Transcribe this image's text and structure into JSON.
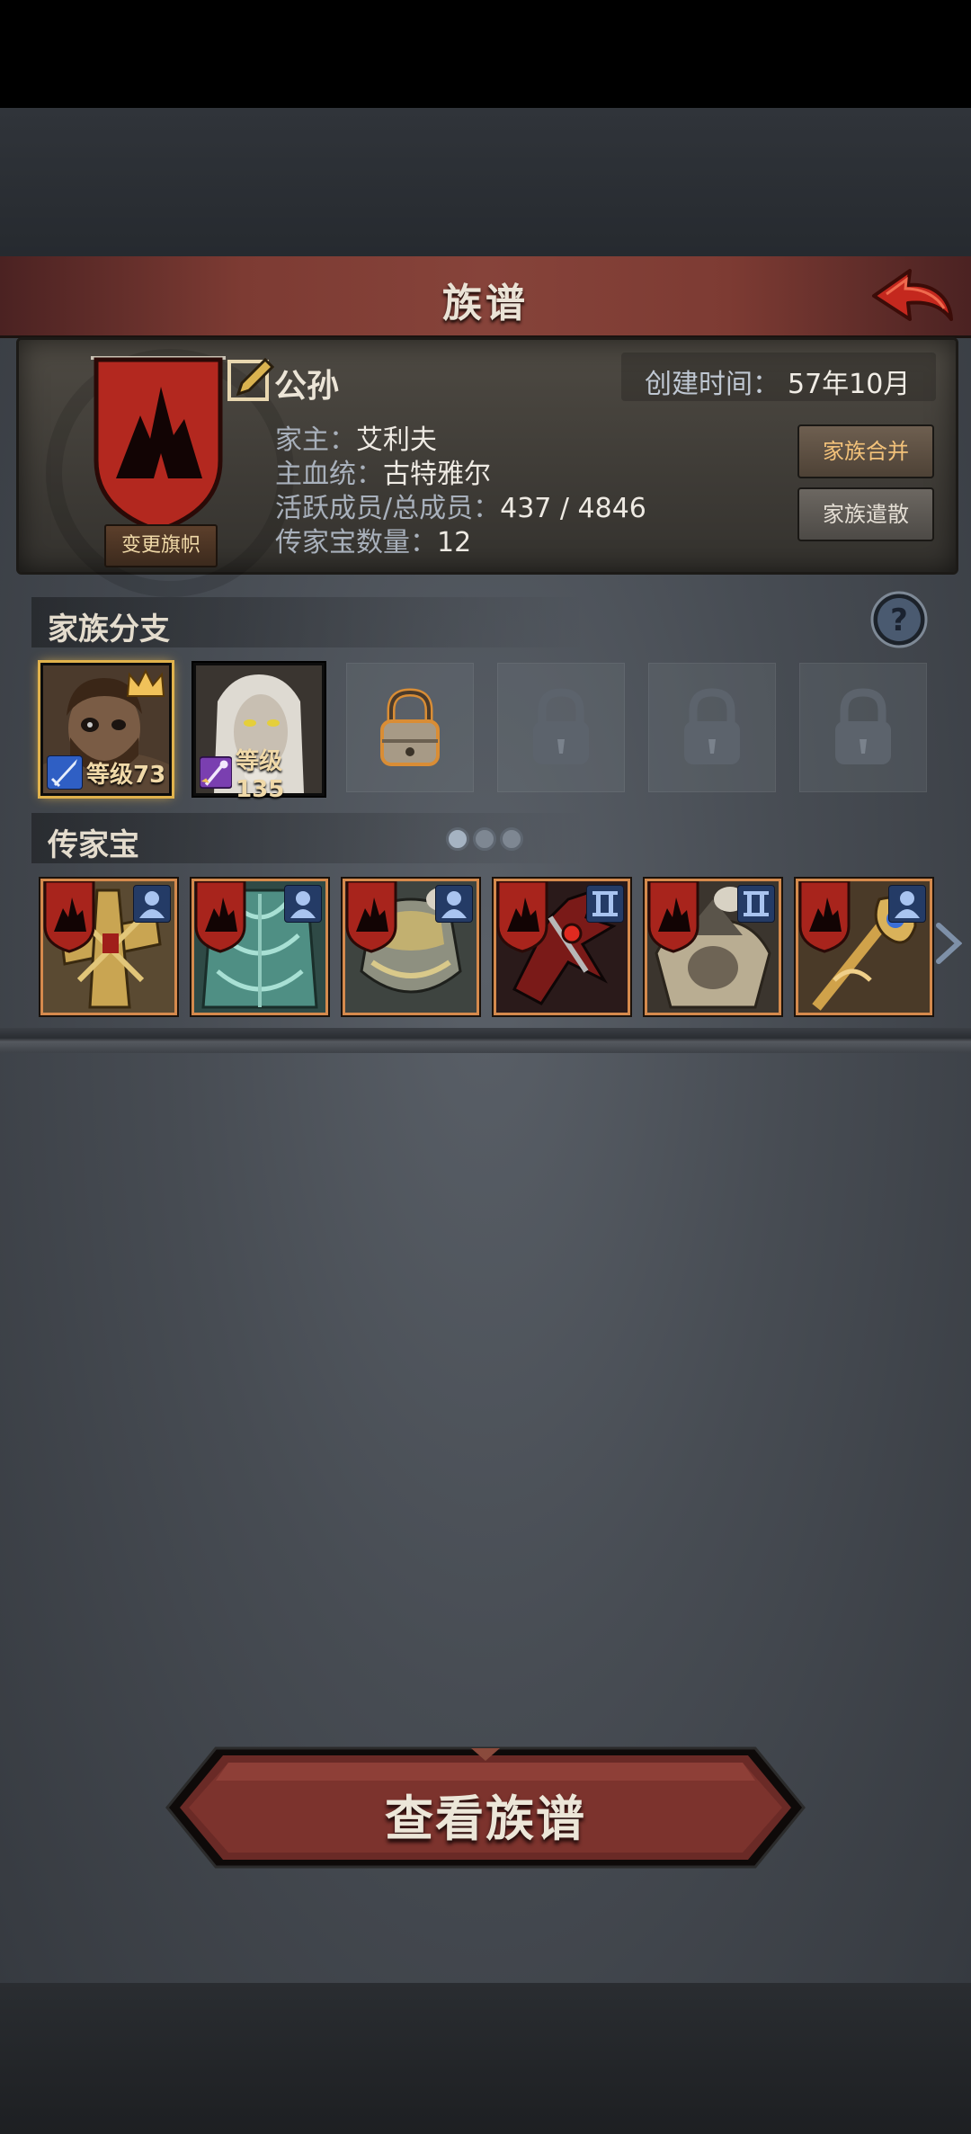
{
  "header": {
    "title": "族谱"
  },
  "family": {
    "name": "公孙",
    "change_flag_label": "变更旗帜",
    "created_label": "创建时间：",
    "created_value": "57年10月",
    "head_label": "家主：",
    "head_value": "艾利夫",
    "bloodline_label": "主血统：",
    "bloodline_value": "古特雅尔",
    "members_label": "活跃成员/总成员：",
    "members_value": "437 / 4846",
    "heirloom_count_label": "传家宝数量：",
    "heirloom_count_value": "12",
    "merge_label": "家族合并",
    "disband_label": "家族遣散",
    "banner_color": "#b3281f"
  },
  "branches": {
    "title": "家族分支",
    "slots": [
      {
        "state": "member",
        "level": "等级73",
        "class": "sword",
        "class_color": "#2f5fc4",
        "is_leader": true
      },
      {
        "state": "member",
        "level": "等级135",
        "class": "staff",
        "class_color": "#7a3fb0",
        "is_leader": false
      },
      {
        "state": "unlockable"
      },
      {
        "state": "locked"
      },
      {
        "state": "locked"
      },
      {
        "state": "locked"
      }
    ]
  },
  "heirlooms": {
    "title": "传家宝",
    "page_index": 1,
    "page_count": 3,
    "items": [
      {
        "name": "golden-cross-shield",
        "type_icon": "person-icon"
      },
      {
        "name": "jade-armor",
        "type_icon": "person-icon"
      },
      {
        "name": "golden-plate-armor",
        "type_icon": "person-icon"
      },
      {
        "name": "red-spiked-axe",
        "type_icon": "roman-two-icon"
      },
      {
        "name": "beast-helm",
        "type_icon": "roman-two-icon"
      },
      {
        "name": "golden-staff",
        "type_icon": "person-icon"
      }
    ]
  },
  "footer": {
    "view_tree_label": "查看族谱"
  }
}
